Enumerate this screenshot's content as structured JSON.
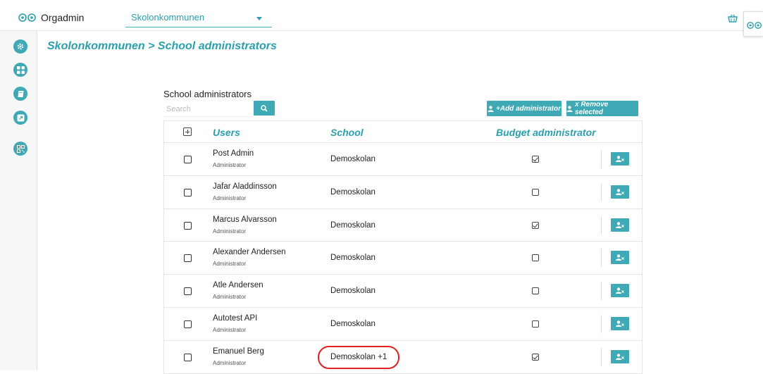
{
  "header": {
    "app_title": "Orgadmin",
    "org_selected": "Skolonkommunen"
  },
  "breadcrumb": "Skolonkommunen > School administrators",
  "section": {
    "title": "School administrators",
    "search_placeholder": "Search",
    "add_label": "+Add administrator",
    "remove_label": "x Remove selected"
  },
  "table": {
    "headers": {
      "users": "Users",
      "school": "School",
      "budget": "Budget administrator"
    },
    "rows": [
      {
        "name": "Post Admin",
        "role": "Administrator",
        "school": "Demoskolan",
        "budget": true
      },
      {
        "name": "Jafar Aladdinsson",
        "role": "Administrator",
        "school": "Demoskolan",
        "budget": false
      },
      {
        "name": "Marcus Alvarsson",
        "role": "Administrator",
        "school": "Demoskolan",
        "budget": true
      },
      {
        "name": "Alexander Andersen",
        "role": "Administrator",
        "school": "Demoskolan",
        "budget": false
      },
      {
        "name": "Atle Andersen",
        "role": "Administrator",
        "school": "Demoskolan",
        "budget": false
      },
      {
        "name": "Autotest API",
        "role": "Administrator",
        "school": "Demoskolan",
        "budget": false
      },
      {
        "name": "Emanuel Berg",
        "role": "Administrator",
        "school": "Demoskolan +1",
        "budget": true
      }
    ]
  },
  "colors": {
    "accent": "#3fa9b5",
    "accent_text": "#2aa0ad",
    "highlight": "#e02020"
  }
}
